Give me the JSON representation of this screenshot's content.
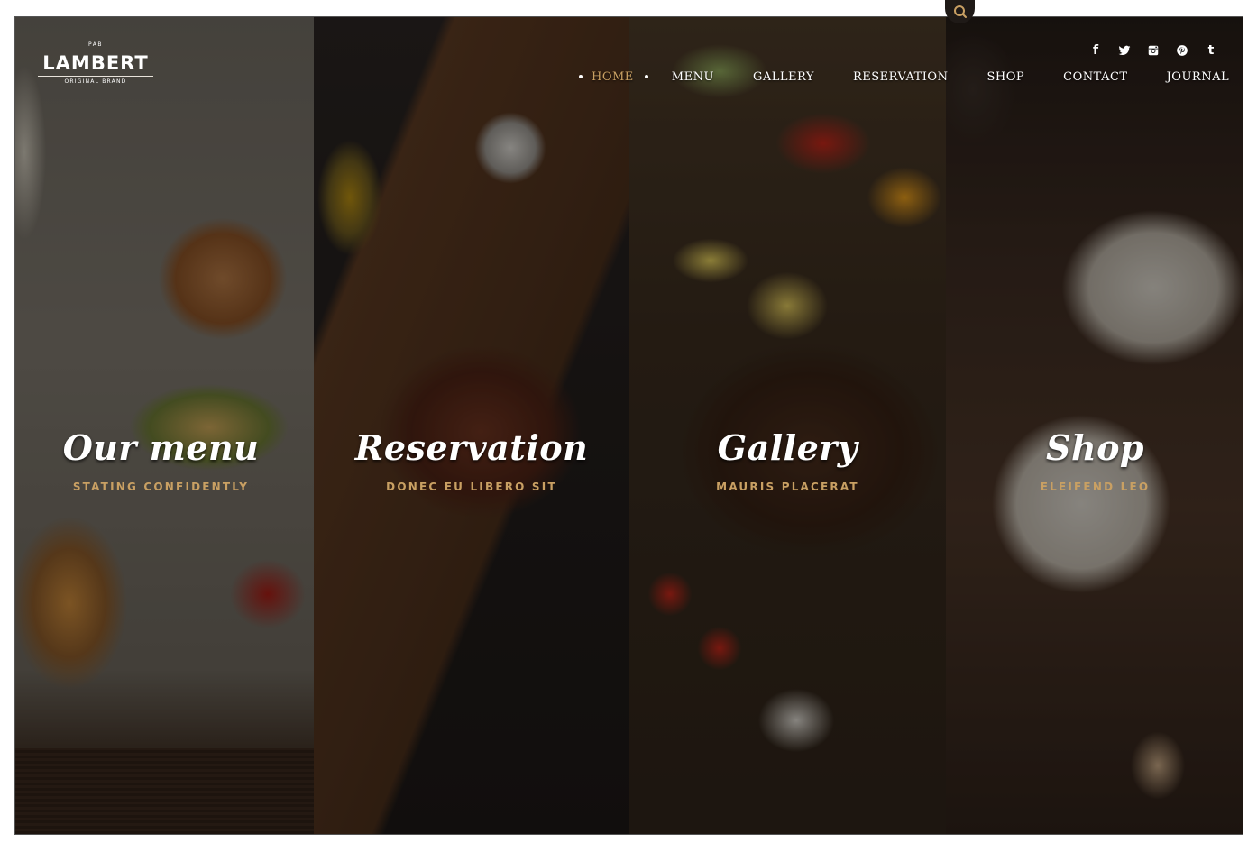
{
  "brand": {
    "pre": "PAB",
    "name": "LAMBERT",
    "tagline": "ORIGINAL BRAND"
  },
  "nav": {
    "items": [
      {
        "label": "HOME",
        "active": true
      },
      {
        "label": "MENU",
        "active": false
      },
      {
        "label": "GALLERY",
        "active": false
      },
      {
        "label": "RESERVATION",
        "active": false
      },
      {
        "label": "SHOP",
        "active": false
      },
      {
        "label": "CONTACT",
        "active": false
      },
      {
        "label": "JOURNAL",
        "active": false
      }
    ]
  },
  "social": [
    {
      "name": "facebook-icon",
      "glyph": "f"
    },
    {
      "name": "twitter-icon",
      "glyph": "twitter"
    },
    {
      "name": "instagram-icon",
      "glyph": "instagram"
    },
    {
      "name": "pinterest-icon",
      "glyph": "pinterest"
    },
    {
      "name": "tumblr-icon",
      "glyph": "t"
    }
  ],
  "search": {
    "icon": "search-icon"
  },
  "panels": [
    {
      "title": "Our menu",
      "subtitle": "STATING CONFIDENTLY"
    },
    {
      "title": "Reservation",
      "subtitle": "DONEC EU LIBERO SIT"
    },
    {
      "title": "Gallery",
      "subtitle": "MAURIS PLACERAT"
    },
    {
      "title": "Shop",
      "subtitle": "ELEIFEND LEO"
    }
  ],
  "colors": {
    "accent": "#c9a063",
    "text": "#ffffff"
  }
}
